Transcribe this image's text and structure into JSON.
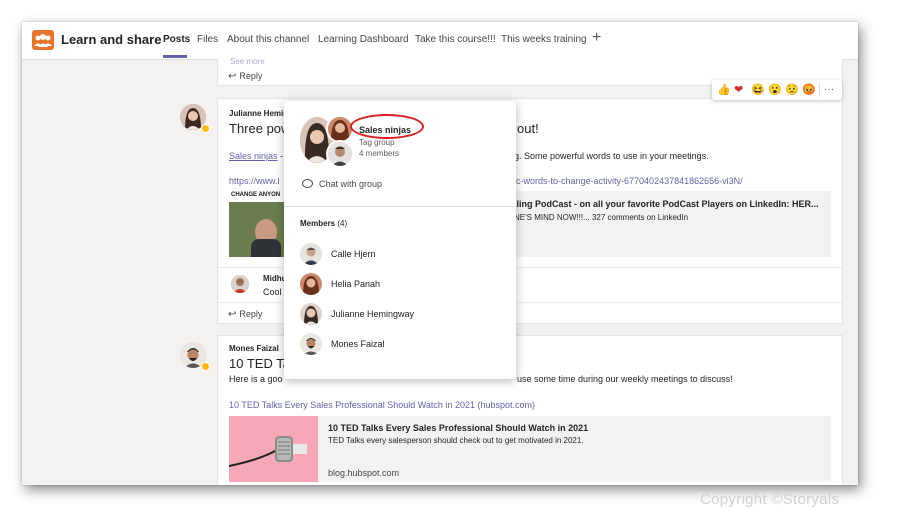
{
  "header": {
    "team_name": "Learn and share",
    "tabs": [
      "Posts",
      "Files",
      "About this channel",
      "Learning Dashboard",
      "Take this course!!!",
      "This weeks training"
    ],
    "add_tab": "+"
  },
  "feed": {
    "reply_label": "Reply",
    "see_more": "See more",
    "post1": {
      "author": "Julianne Hemin",
      "title_start": "Three pow",
      "title_end": "out!",
      "body_mention": "Sales ninjas",
      "body_start": " -",
      "body_end": "g. Some powerful words to use in your meetings.",
      "link_start": "https://www.l",
      "link_end": "ic-words-to-change-activity-6770402437841862656-vl3N/",
      "image_caption": "CHANGE ANYON",
      "preview_title": "lling PodCast - on all your favorite PodCast Players on LinkedIn: HER...",
      "preview_desc": "NE'S MIND NOW!!!... 327 comments on LinkedIn",
      "reply_author": "Midhu",
      "reply_text": "Cool"
    },
    "post2": {
      "author": "Mones Faizal",
      "title": "10 TED Talk",
      "body_start": "Here is a goo",
      "body_end": "use some time during our weekly meetings to discuss!",
      "link": "10 TED Talks Every Sales Professional Should Watch in 2021 (hubspot.com)",
      "preview_title": "10 TED Talks Every Sales Professional Should Watch in 2021",
      "preview_desc": "TED Talks every salesperson should check out to get motivated in 2021.",
      "preview_domain": "blog.hubspot.com"
    }
  },
  "reactions": [
    "👍",
    "❤",
    "😆",
    "😮",
    "😟",
    "😡"
  ],
  "reactions_more": "···",
  "popup": {
    "group_name": "Sales ninjas",
    "group_type": "Tag group",
    "member_count": "4 members",
    "chat_label": "Chat with group",
    "members_label": "Members",
    "members_count": "(4)",
    "members": [
      "Calle Hjern",
      "Helia Panah",
      "Julianne Hemingway",
      "Mones Faizal"
    ]
  },
  "watermark": "Copyright ©Storyals",
  "colors": {
    "accent": "#6264a7",
    "highlight_ring": "#d81e1e",
    "status": "#fdb913"
  }
}
